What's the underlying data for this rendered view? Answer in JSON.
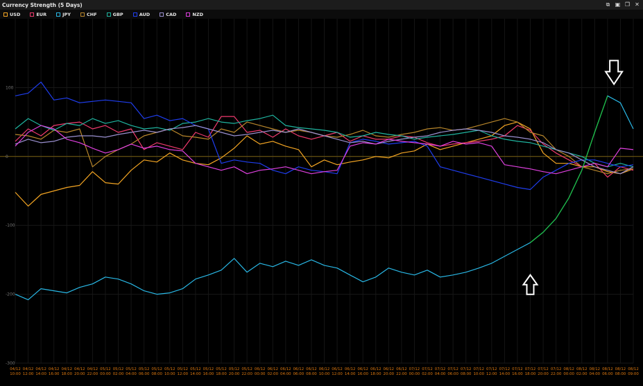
{
  "window": {
    "title": "Currency Strength (5 Days)",
    "controls": [
      "restore-icon",
      "lock-icon",
      "copy-icon",
      "close-icon"
    ]
  },
  "legend": [
    {
      "code": "USD",
      "color": "#f5a623"
    },
    {
      "code": "EUR",
      "color": "#f03a6e"
    },
    {
      "code": "JPY",
      "color": "#29b8e6"
    },
    {
      "code": "CHF",
      "color": "#b8862b"
    },
    {
      "code": "GBP",
      "color": "#1fb5a0"
    },
    {
      "code": "AUD",
      "color": "#1f3ef0"
    },
    {
      "code": "CAD",
      "color": "#9a90d0"
    },
    {
      "code": "NZD",
      "color": "#e040e0"
    }
  ],
  "chart_data": {
    "type": "line",
    "title": "",
    "xlabel": "",
    "ylabel": "",
    "ylim": [
      -300,
      200
    ],
    "y_ticks": [
      100,
      0,
      -100,
      -200,
      -300
    ],
    "x_ticks": [
      [
        "04/12",
        "10:00"
      ],
      [
        "04/12",
        "12:00"
      ],
      [
        "04/12",
        "14:00"
      ],
      [
        "04/12",
        "16:00"
      ],
      [
        "04/12",
        "18:00"
      ],
      [
        "04/12",
        "20:00"
      ],
      [
        "04/12",
        "22:00"
      ],
      [
        "05/12",
        "00:00"
      ],
      [
        "05/12",
        "02:00"
      ],
      [
        "05/12",
        "04:00"
      ],
      [
        "05/12",
        "06:00"
      ],
      [
        "05/12",
        "08:00"
      ],
      [
        "05/12",
        "10:00"
      ],
      [
        "05/12",
        "12:00"
      ],
      [
        "05/12",
        "14:00"
      ],
      [
        "05/12",
        "16:00"
      ],
      [
        "05/12",
        "18:00"
      ],
      [
        "05/12",
        "20:00"
      ],
      [
        "05/12",
        "22:00"
      ],
      [
        "06/12",
        "00:00"
      ],
      [
        "06/12",
        "02:00"
      ],
      [
        "06/12",
        "04:00"
      ],
      [
        "06/12",
        "06:00"
      ],
      [
        "06/12",
        "08:00"
      ],
      [
        "06/12",
        "10:00"
      ],
      [
        "06/12",
        "12:00"
      ],
      [
        "06/12",
        "14:00"
      ],
      [
        "06/12",
        "16:00"
      ],
      [
        "06/12",
        "18:00"
      ],
      [
        "06/12",
        "20:00"
      ],
      [
        "06/12",
        "22:00"
      ],
      [
        "07/12",
        "00:00"
      ],
      [
        "07/12",
        "02:00"
      ],
      [
        "07/12",
        "04:00"
      ],
      [
        "07/12",
        "06:00"
      ],
      [
        "07/12",
        "08:00"
      ],
      [
        "07/12",
        "10:00"
      ],
      [
        "07/12",
        "12:00"
      ],
      [
        "07/12",
        "14:00"
      ],
      [
        "07/12",
        "16:00"
      ],
      [
        "07/12",
        "18:00"
      ],
      [
        "07/12",
        "20:00"
      ],
      [
        "07/12",
        "22:00"
      ],
      [
        "08/12",
        "00:00"
      ],
      [
        "08/12",
        "02:00"
      ],
      [
        "08/12",
        "04:00"
      ],
      [
        "08/12",
        "06:00"
      ],
      [
        "08/12",
        "08:00"
      ],
      [
        "08/12",
        "09:00"
      ]
    ],
    "grid": true,
    "legend_position": "top-left",
    "annotations": [
      {
        "type": "arrow-down",
        "x_index": 46.5,
        "y": 105
      },
      {
        "type": "arrow-up",
        "x_index": 40,
        "y": -172
      }
    ],
    "series": [
      {
        "name": "USD",
        "color": "#f5a623",
        "values": [
          -52,
          -72,
          -55,
          -50,
          -45,
          -42,
          -22,
          -38,
          -40,
          -20,
          -5,
          -8,
          5,
          -5,
          -10,
          -12,
          -2,
          12,
          30,
          18,
          22,
          15,
          10,
          -15,
          -5,
          -12,
          -8,
          -5,
          0,
          -2,
          5,
          8,
          18,
          10,
          15,
          20,
          25,
          30,
          45,
          50,
          40,
          5,
          -10,
          -10,
          -15,
          -15,
          -22,
          -25,
          -18
        ]
      },
      {
        "name": "EUR",
        "color": "#f03a6e",
        "values": [
          22,
          40,
          30,
          45,
          48,
          50,
          40,
          45,
          35,
          40,
          10,
          20,
          15,
          10,
          35,
          28,
          58,
          58,
          35,
          38,
          28,
          40,
          30,
          25,
          30,
          35,
          22,
          30,
          25,
          25,
          30,
          28,
          20,
          15,
          18,
          20,
          22,
          25,
          30,
          45,
          38,
          18,
          5,
          -5,
          -15,
          -10,
          -30,
          -15,
          -20
        ]
      },
      {
        "name": "JPY",
        "color": "#29b8e6",
        "values": [
          -200,
          -208,
          -192,
          -195,
          -198,
          -190,
          -185,
          -175,
          -178,
          -185,
          -195,
          -200,
          -198,
          -192,
          -178,
          -172,
          -165,
          -148,
          -168,
          -155,
          -160,
          -152,
          -158,
          -150,
          -158,
          -162,
          -172,
          -182,
          -175,
          -162,
          -168,
          -172,
          -165,
          -175,
          -172,
          -168,
          -162,
          -155,
          -145,
          -135,
          -125,
          -110,
          -90,
          -60,
          -20,
          35,
          88,
          78,
          40
        ]
      },
      {
        "name": "CHF",
        "color": "#b8862b",
        "values": [
          32,
          30,
          25,
          38,
          35,
          40,
          -15,
          0,
          10,
          18,
          30,
          35,
          40,
          30,
          28,
          25,
          40,
          35,
          50,
          45,
          40,
          35,
          38,
          35,
          30,
          28,
          32,
          38,
          30,
          28,
          32,
          35,
          40,
          42,
          38,
          40,
          45,
          50,
          55,
          50,
          35,
          30,
          10,
          0,
          -15,
          -20,
          -25,
          -20,
          -18
        ]
      },
      {
        "name": "GBP",
        "color": "#1fb5a0",
        "values": [
          40,
          55,
          45,
          38,
          48,
          45,
          55,
          48,
          52,
          45,
          40,
          42,
          38,
          48,
          50,
          55,
          50,
          48,
          52,
          55,
          60,
          45,
          42,
          40,
          38,
          35,
          28,
          30,
          35,
          32,
          30,
          25,
          28,
          30,
          32,
          35,
          38,
          30,
          25,
          22,
          20,
          15,
          10,
          5,
          0,
          -10,
          -15,
          -10,
          -15
        ]
      },
      {
        "name": "AUD",
        "color": "#1f3ef0",
        "values": [
          88,
          92,
          108,
          82,
          85,
          78,
          80,
          82,
          80,
          78,
          55,
          60,
          52,
          55,
          45,
          40,
          -10,
          -5,
          -8,
          -10,
          -20,
          -25,
          -15,
          -20,
          -22,
          -25,
          20,
          25,
          22,
          18,
          20,
          22,
          15,
          -15,
          -20,
          -25,
          -30,
          -35,
          -40,
          -45,
          -48,
          -30,
          -20,
          -10,
          -5,
          -5,
          -10,
          -15,
          -12
        ]
      },
      {
        "name": "CAD",
        "color": "#9a90d0",
        "values": [
          18,
          25,
          20,
          22,
          28,
          30,
          30,
          28,
          32,
          35,
          38,
          35,
          40,
          42,
          45,
          40,
          35,
          30,
          32,
          35,
          38,
          35,
          40,
          35,
          30,
          25,
          20,
          22,
          18,
          22,
          25,
          28,
          30,
          35,
          38,
          40,
          38,
          35,
          30,
          28,
          25,
          20,
          10,
          5,
          -5,
          -15,
          -20,
          -25,
          -15
        ]
      },
      {
        "name": "NZD",
        "color": "#e040e0",
        "values": [
          15,
          35,
          45,
          40,
          25,
          20,
          12,
          5,
          10,
          18,
          12,
          15,
          10,
          8,
          -10,
          -15,
          -20,
          -15,
          -25,
          -20,
          -18,
          -15,
          -20,
          -25,
          -22,
          -20,
          15,
          20,
          18,
          25,
          22,
          20,
          18,
          15,
          22,
          18,
          20,
          15,
          -12,
          -15,
          -18,
          -22,
          -25,
          -20,
          -15,
          -10,
          -15,
          12,
          10
        ]
      }
    ]
  }
}
